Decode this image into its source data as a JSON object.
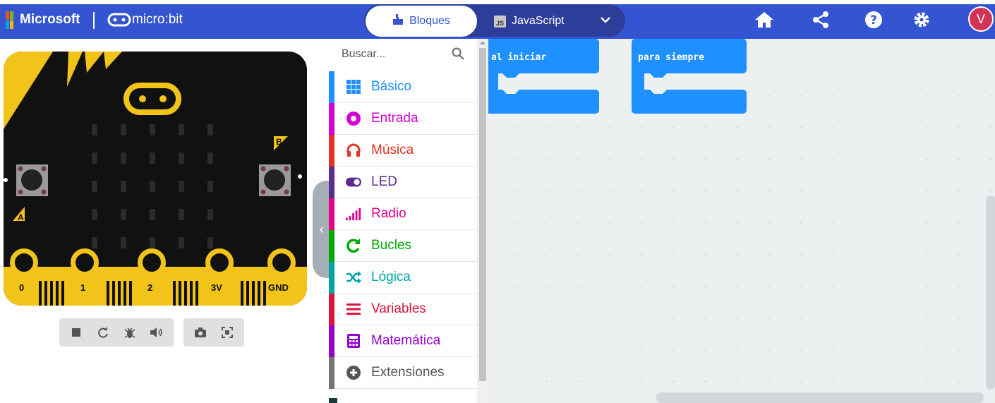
{
  "header": {
    "brand": "Microsoft",
    "product": "micro:bit",
    "tabs": [
      {
        "label": "Bloques",
        "active": true
      },
      {
        "label": "JavaScript",
        "active": false
      }
    ],
    "js_badge": "JS",
    "avatar_initial": "V",
    "icons": [
      "home-icon",
      "share-icon",
      "help-icon",
      "settings-icon"
    ]
  },
  "simulator": {
    "pins": [
      "0",
      "1",
      "2",
      "3V",
      "GND"
    ],
    "button_a": "A",
    "button_b": "B",
    "toolbar_icons": [
      "stop-icon",
      "restart-icon",
      "debug-icon",
      "mute-icon",
      "screenshot-icon",
      "fullscreen-icon"
    ]
  },
  "toolbox": {
    "search_placeholder": "Buscar...",
    "categories": [
      {
        "label": "Básico",
        "color": "#1e90ff",
        "icon": "grid-icon"
      },
      {
        "label": "Entrada",
        "color": "#d400d4",
        "icon": "input-icon"
      },
      {
        "label": "Música",
        "color": "#e63022",
        "icon": "headphones-icon"
      },
      {
        "label": "LED",
        "color": "#5c2d91",
        "icon": "toggle-icon"
      },
      {
        "label": "Radio",
        "color": "#e3008c",
        "icon": "signal-icon"
      },
      {
        "label": "Bucles",
        "color": "#00aa00",
        "icon": "loop-icon"
      },
      {
        "label": "Lógica",
        "color": "#00a4a6",
        "icon": "shuffle-icon"
      },
      {
        "label": "Variables",
        "color": "#dc143c",
        "icon": "lines-icon"
      },
      {
        "label": "Matemática",
        "color": "#9400d3",
        "icon": "calculator-icon"
      },
      {
        "label": "Extensiones",
        "color": "#757575",
        "icon": "plus-circle-icon"
      }
    ]
  },
  "workspace": {
    "blocks": [
      {
        "label": "al iniciar"
      },
      {
        "label": "para siempre"
      }
    ]
  },
  "colors": {
    "header": "#3454d1",
    "board_gold": "#f2c318",
    "block_blue": "#1e90ff"
  }
}
